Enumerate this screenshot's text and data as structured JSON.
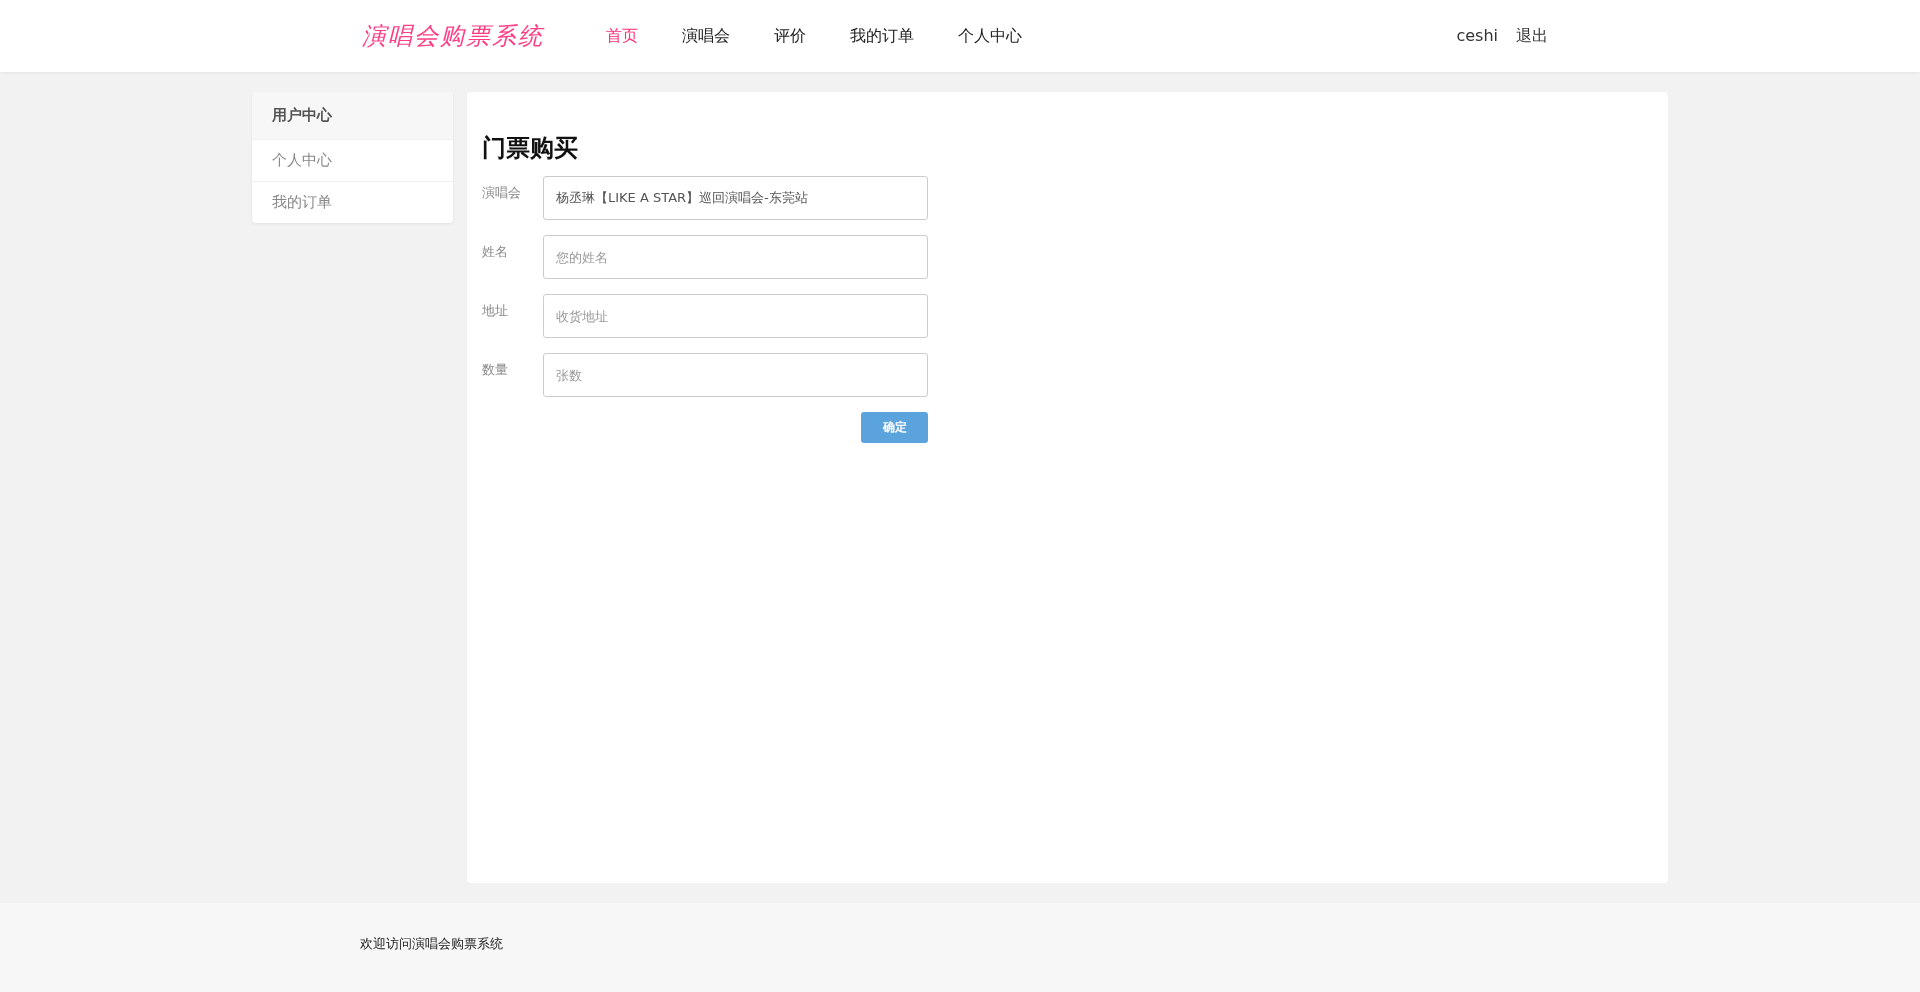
{
  "header": {
    "logo": "演唱会购票系统",
    "nav": [
      {
        "label": "首页",
        "selected": true
      },
      {
        "label": "演唱会",
        "selected": false
      },
      {
        "label": "评价",
        "selected": false
      },
      {
        "label": "我的订单",
        "selected": false
      },
      {
        "label": "个人中心",
        "selected": false
      }
    ],
    "username": "ceshi",
    "logout": "退出"
  },
  "sidebar": {
    "title": "用户中心",
    "items": [
      "个人中心",
      "我的订单"
    ]
  },
  "form": {
    "title": "门票购买",
    "fields": [
      {
        "label": "演唱会",
        "value": "杨丞琳【LIKE A STAR】巡回演唱会-东莞站"
      },
      {
        "label": "姓名",
        "placeholder": "您的姓名"
      },
      {
        "label": "地址",
        "placeholder": "收货地址"
      },
      {
        "label": "数量",
        "placeholder": "张数"
      }
    ],
    "submit": "确定"
  },
  "footer": "欢迎访问演唱会购票系统"
}
